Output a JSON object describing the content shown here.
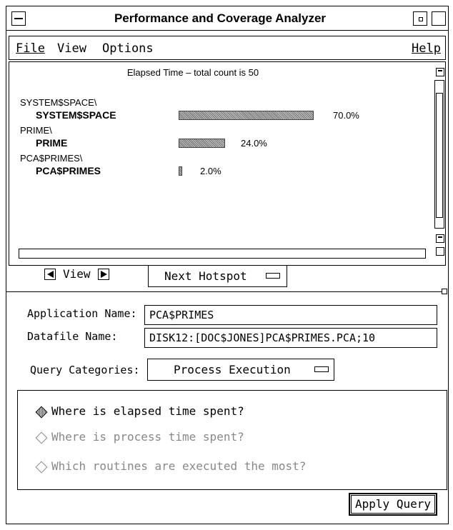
{
  "window": {
    "title": "Performance and Coverage Analyzer"
  },
  "menubar": {
    "file": "File",
    "view": "View",
    "options": "Options",
    "help": "Help"
  },
  "histogram": {
    "title": "Elapsed Time – total count is 50",
    "entries": [
      {
        "path": "SYSTEM$SPACE\\",
        "name": "SYSTEM$SPACE",
        "percent": "70.0%",
        "fraction": 0.7
      },
      {
        "path": "PRIME\\",
        "name": "PRIME",
        "percent": "24.0%",
        "fraction": 0.24
      },
      {
        "path": "PCA$PRIMES\\",
        "name": "PCA$PRIMES",
        "percent": "2.0%",
        "fraction": 0.02
      }
    ]
  },
  "nav": {
    "view_label": "View",
    "hotspot_label": "Next Hotspot"
  },
  "form": {
    "app_label": "Application Name:",
    "app_value": "PCA$PRIMES",
    "datafile_label": "Datafile Name:",
    "datafile_value": "DISK12:[DOC$JONES]PCA$PRIMES.PCA;10",
    "query_label": "Query Categories:",
    "query_value": "Process Execution"
  },
  "queries": [
    {
      "label": "Where is elapsed time spent?",
      "selected": true
    },
    {
      "label": "Where is process time spent?",
      "selected": false
    },
    {
      "label": "Which routines are executed the most?",
      "selected": false
    }
  ],
  "apply_label": "Apply Query"
}
